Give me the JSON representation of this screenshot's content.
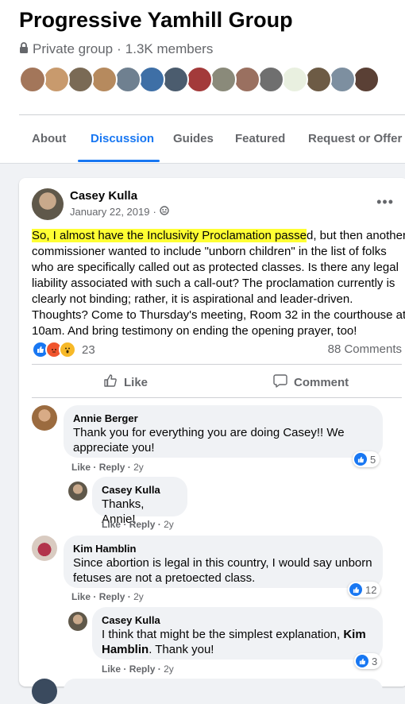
{
  "group": {
    "title": "Progressive Yamhill Group",
    "privacy": "Private group",
    "members": "1.3K members",
    "separator": "·",
    "member_avatar_colors": [
      "#a3765a",
      "#c89a6d",
      "#7a6a55",
      "#b68a5e",
      "#6f8090",
      "#3e6fa6",
      "#4b5c6e",
      "#a33a3a",
      "#8a8a7a",
      "#9a7060",
      "#6f6f6f",
      "#e9f0e0",
      "#6d5b45",
      "#7d8fa0",
      "#5a4035"
    ]
  },
  "tabs": [
    "About",
    "Discussion",
    "Guides",
    "Featured",
    "Request or Offer H"
  ],
  "active_tab": "Discussion",
  "post": {
    "author": "Casey Kulla",
    "date": "January 22, 2019",
    "date_sep": "·",
    "highlight": "So, I almost have the Inclusivity Proclamation passe",
    "text": "d, but then another commissioner wanted to include \"unborn children\" in the list of folks who are specifically called out as protected classes. Is there any legal liability associated with such a call-out? The proclamation currently is clearly not binding; rather, it is aspirational and leader-driven. Thoughts? Come to Thursday's meeting, Room 32 in the courthouse at 10am. And bring testimony on ending the opening prayer, too!",
    "reaction_count": "23",
    "comments_count": "88 Comments",
    "like_label": "Like",
    "comment_label": "Comment"
  },
  "comments": [
    {
      "name": "Annie Berger",
      "text": "Thank you for everything you are doing Casey!! We appreciate you!",
      "like": "Like",
      "reply": "Reply",
      "sep": "·",
      "age": "2y",
      "reactions": "5"
    },
    {
      "name": "Casey Kulla",
      "text": "Thanks, Annie!",
      "like": "Like",
      "reply": "Reply",
      "sep": "·",
      "age": "2y"
    },
    {
      "name": "Kim Hamblin",
      "text": "Since abortion is legal in this country, I would say unborn fetuses are not a pretoected class.",
      "like": "Like",
      "reply": "Reply",
      "sep": "·",
      "age": "2y",
      "reactions": "12"
    },
    {
      "name": "Casey Kulla",
      "text_before": "I think that might be the simplest explanation, ",
      "mention": "Kim Hamblin",
      "text_after": ". Thank you!",
      "like": "Like",
      "reply": "Reply",
      "sep": "·",
      "age": "2y",
      "reactions": "3"
    }
  ],
  "colors": {
    "accent": "#1877f2",
    "secondary_text": "#65676b",
    "highlight": "#ffff33"
  }
}
